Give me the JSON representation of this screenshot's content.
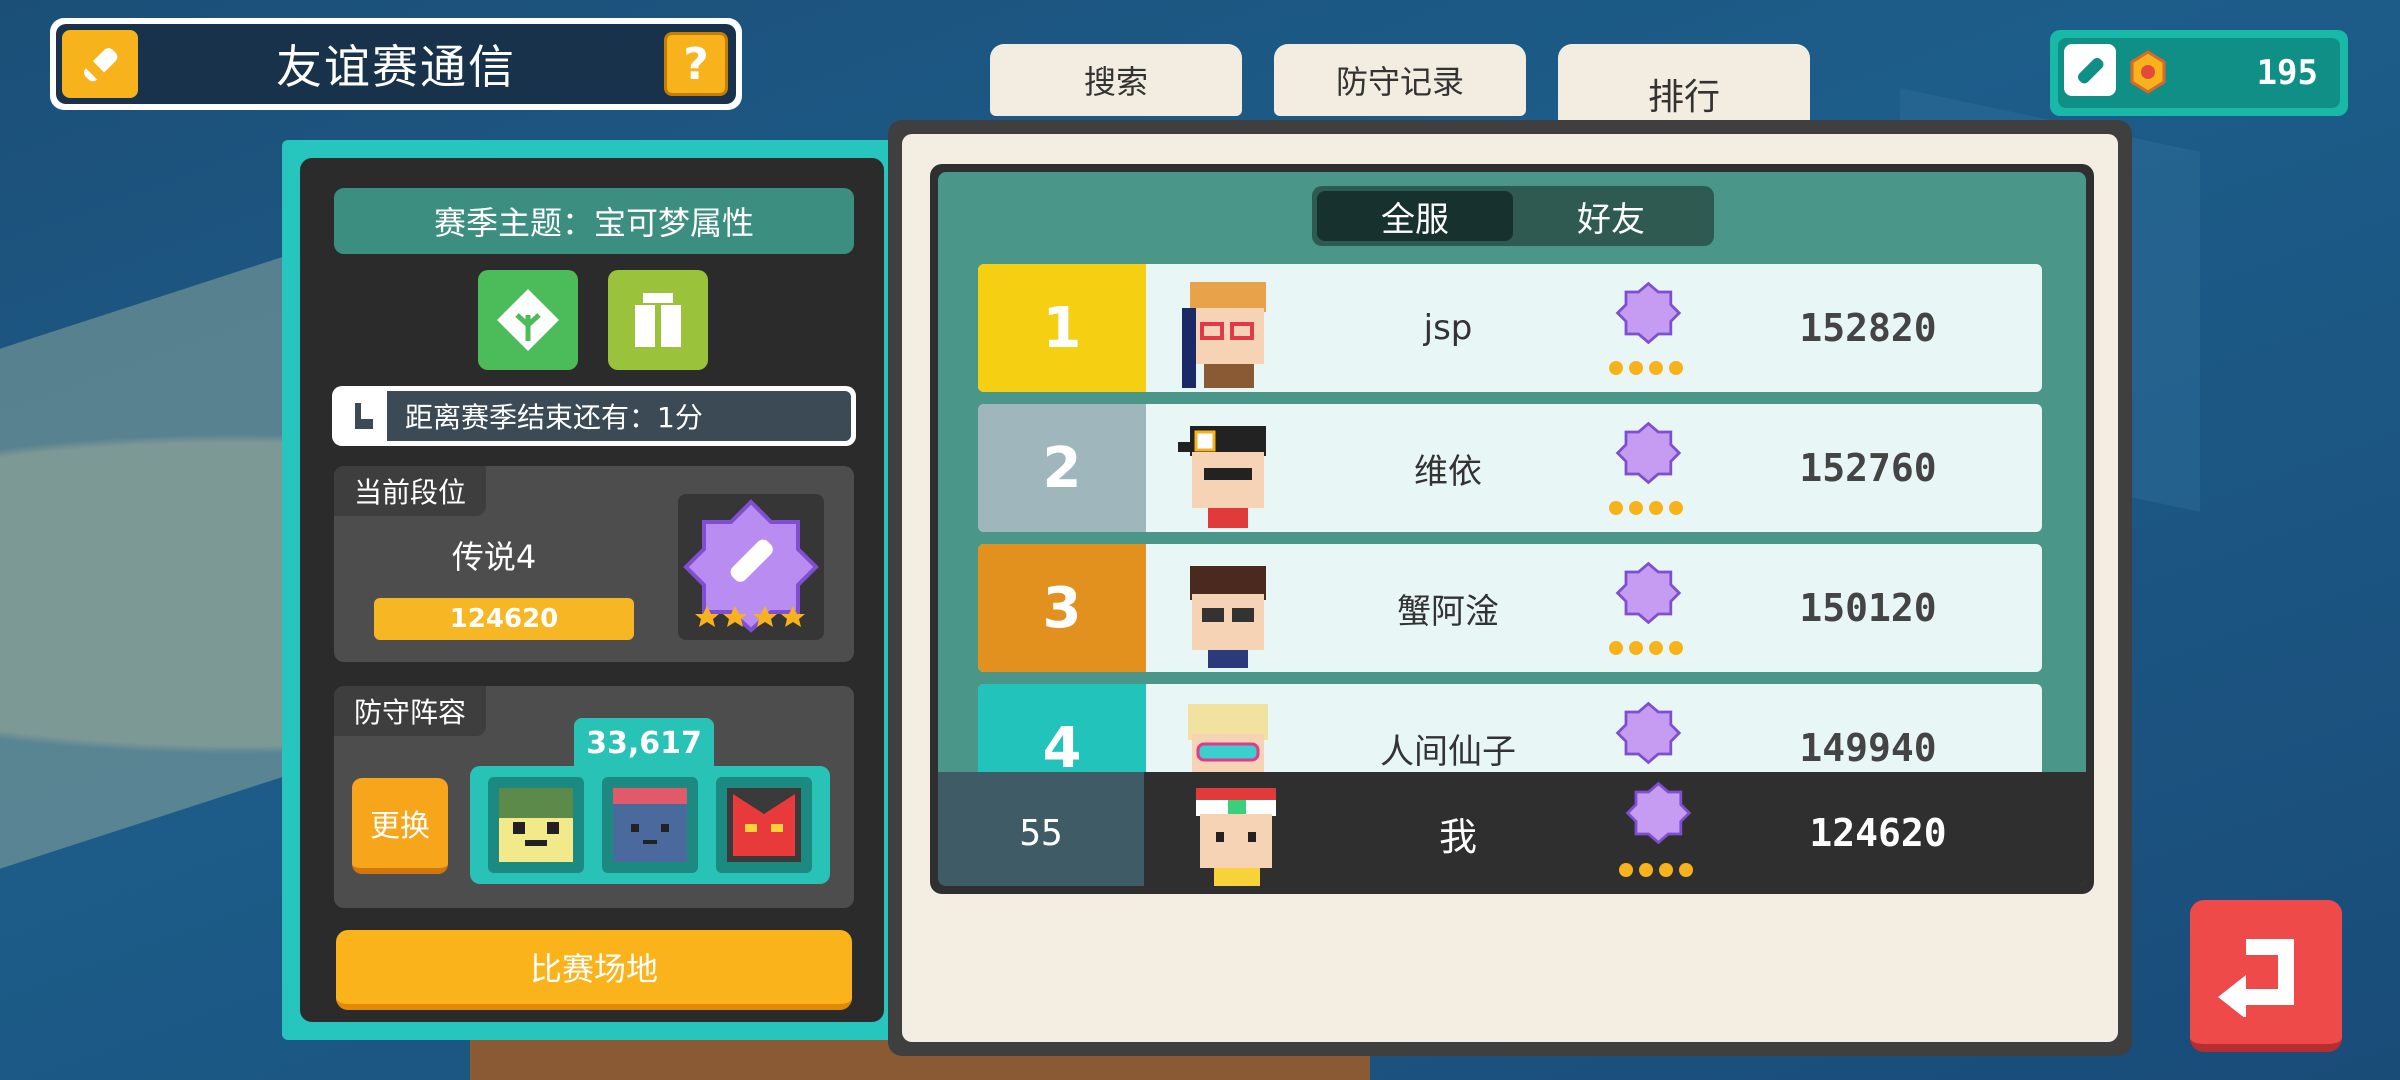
{
  "header": {
    "title": "友谊赛通信",
    "help_label": "?"
  },
  "currency": {
    "value": "195"
  },
  "tabs": [
    {
      "label": "搜索",
      "active": false
    },
    {
      "label": "防守记录",
      "active": false
    },
    {
      "label": "排行",
      "active": true
    }
  ],
  "season": {
    "theme": "赛季主题：宝可梦属性",
    "countdown": "距离赛季结束还有：1分",
    "type_icons": [
      "grass-type-icon",
      "normal-type-icon"
    ]
  },
  "current_rank": {
    "label": "当前段位",
    "tier": "传说4",
    "score": "124620",
    "stars": 4
  },
  "defense": {
    "label": "防守阵容",
    "power": "33,617",
    "change_label": "更换",
    "team": [
      "green-pokemon",
      "purple-pokemon",
      "red-pokemon"
    ]
  },
  "venue_button": "比赛场地",
  "leaderboard": {
    "filters": [
      {
        "label": "全服",
        "active": true
      },
      {
        "label": "好友",
        "active": false
      }
    ],
    "rows": [
      {
        "rank": "1",
        "name": "jsp",
        "score": "152820",
        "color": "#f5cf11"
      },
      {
        "rank": "2",
        "name": "维依",
        "score": "152760",
        "color": "#9fb6bd"
      },
      {
        "rank": "3",
        "name": "蟹阿淦",
        "score": "150120",
        "color": "#e2901e"
      },
      {
        "rank": "4",
        "name": "人间仙子",
        "score": "149940",
        "color": "#22c3bb"
      }
    ],
    "me": {
      "rank": "55",
      "name": "我",
      "score": "124620"
    }
  },
  "colors": {
    "accent": "#26c6bf",
    "gold": "#f7b21c",
    "back": "#ef4a4a"
  }
}
